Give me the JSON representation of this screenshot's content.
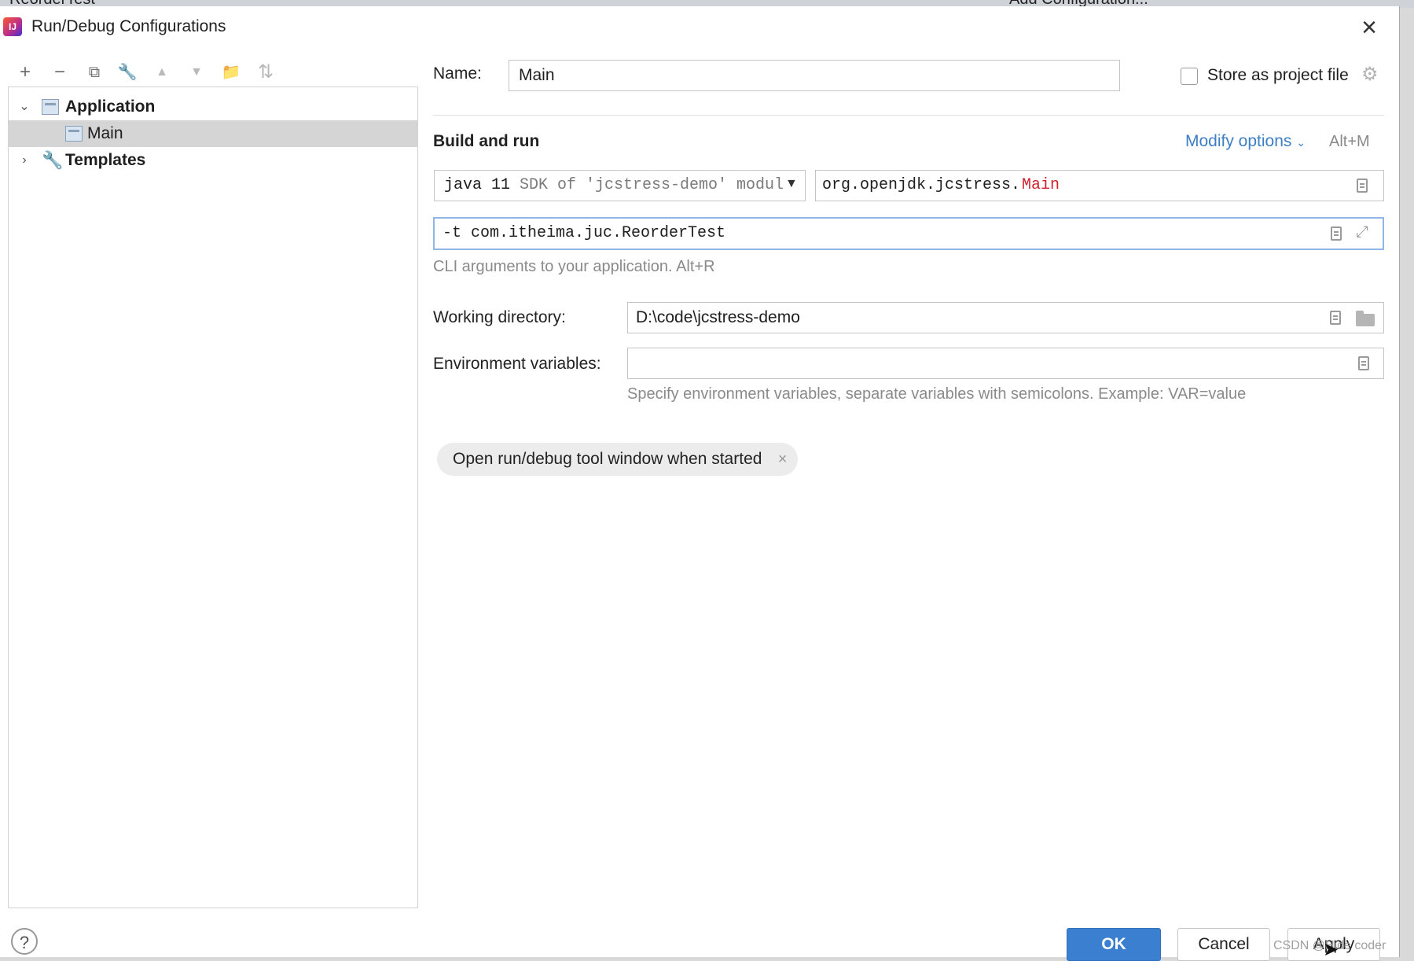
{
  "window": {
    "behind_title": "ReorderTest",
    "behind_config": "Add Configuration...",
    "title": "Run/Debug Configurations",
    "app_icon_text": "IJ"
  },
  "toolbar": [
    {
      "name": "add-icon",
      "glyph": "+"
    },
    {
      "name": "remove-icon",
      "glyph": "−"
    },
    {
      "name": "copy-icon",
      "glyph": "⧉"
    },
    {
      "name": "edit-templates-icon",
      "glyph": "🔧"
    },
    {
      "name": "move-up-icon",
      "glyph": "▲"
    },
    {
      "name": "move-down-icon",
      "glyph": "▼"
    },
    {
      "name": "new-folder-icon",
      "glyph": "📁"
    },
    {
      "name": "sort-icon",
      "glyph": "⇅"
    }
  ],
  "tree": {
    "application": "Application",
    "main": "Main",
    "templates": "Templates"
  },
  "form": {
    "name_label": "Name:",
    "name_value": "Main",
    "store_label": "Store as project file",
    "section_title": "Build and run",
    "modify_options": "Modify options",
    "modify_shortcut": "Alt+M",
    "jdk_java": "java 11",
    "jdk_rest": "SDK of 'jcstress-demo' modul",
    "main_class_prefix": "org.openjdk.jcstress.",
    "main_class_name": "Main",
    "program_args": "-t com.itheima.juc.ReorderTest",
    "program_args_hint": "CLI arguments to your application. Alt+R",
    "workdir_label": "Working directory:",
    "workdir_value": "D:\\code\\jcstress-demo",
    "env_label": "Environment variables:",
    "env_value": "",
    "env_hint": "Specify environment variables, separate variables with semicolons. Example: VAR=value",
    "chip_label": "Open run/debug tool window when started"
  },
  "buttons": {
    "ok": "OK",
    "cancel": "Cancel",
    "apply": "Apply"
  },
  "watermark": "CSDN @Hide coder",
  "colors": {
    "accent": "#3a7fd0",
    "link": "#3d7ec4",
    "main_class_highlight": "#d0212f",
    "selection": "#d5d5d5"
  }
}
